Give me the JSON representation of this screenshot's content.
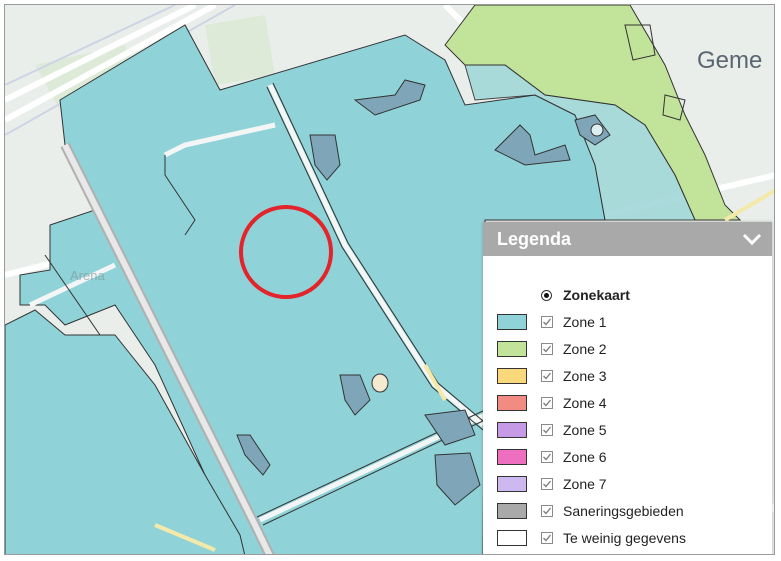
{
  "map": {
    "place_labels": [
      "Geme",
      "Arena"
    ],
    "colors": {
      "background": "#eaeeea",
      "zone1_fill": "#8fd3d8",
      "zone2_fill": "#c2e39a",
      "road": "#ffffff",
      "outline": "#333333",
      "marker": "#e3242b"
    },
    "marker": "red-circle-marker"
  },
  "legend": {
    "title": "Legenda",
    "collapse_icon": "chevron-down-icon",
    "layer": {
      "label": "Zonekaart",
      "selected": true
    },
    "items": [
      {
        "label": "Zone 1",
        "color": "#8fd3d8",
        "checked": true
      },
      {
        "label": "Zone 2",
        "color": "#c2e39a",
        "checked": true
      },
      {
        "label": "Zone 3",
        "color": "#fbd87a",
        "checked": true
      },
      {
        "label": "Zone 4",
        "color": "#f28b82",
        "checked": true
      },
      {
        "label": "Zone 5",
        "color": "#c79ae8",
        "checked": true
      },
      {
        "label": "Zone 6",
        "color": "#ee6fbf",
        "checked": true
      },
      {
        "label": "Zone 7",
        "color": "#cdb9ef",
        "checked": true
      },
      {
        "label": "Saneringsgebieden",
        "color": "#a9a9a9",
        "checked": true
      },
      {
        "label": "Te weinig gegevens",
        "color": "#ffffff",
        "checked": true
      }
    ]
  }
}
